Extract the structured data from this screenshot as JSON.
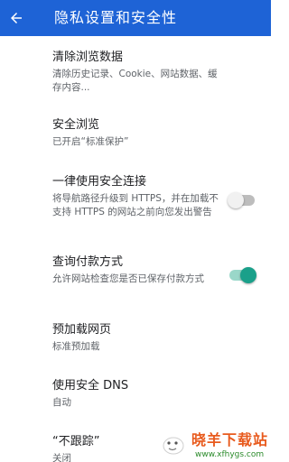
{
  "appbar": {
    "title": "隐私设置和安全性"
  },
  "settings": [
    {
      "title": "清除浏览数据",
      "summary": "清除历史记录、Cookie、网站数据、缓存内容..."
    },
    {
      "title": "安全浏览",
      "summary": "已开启“标准保护”"
    },
    {
      "title": "一律使用安全连接",
      "summary": "将导航路径升级到 HTTPS，并在加载不支持 HTTPS 的网站之前向您发出警告",
      "toggle": "off"
    },
    {
      "title": "查询付款方式",
      "summary": "允许网站检查您是否已保存付款方式",
      "toggle": "on"
    },
    {
      "title": "预加载网页",
      "summary": "标准预加载"
    },
    {
      "title": "使用安全 DNS",
      "summary": "自动"
    },
    {
      "title": "“不跟踪”",
      "summary": "关闭"
    }
  ],
  "watermark": {
    "name": "晓羊下载站",
    "url": "www.xfhygs.com"
  },
  "colors": {
    "appbar": "#1e63d6",
    "toggle_on": "#1aa08a",
    "toggle_off": "#bdbdbd",
    "watermark_title": "#e85a1d",
    "watermark_url": "#2b8b2b"
  },
  "icons": {
    "back": "arrow-back-icon",
    "watermark_logo": "sheep-logo-icon"
  }
}
